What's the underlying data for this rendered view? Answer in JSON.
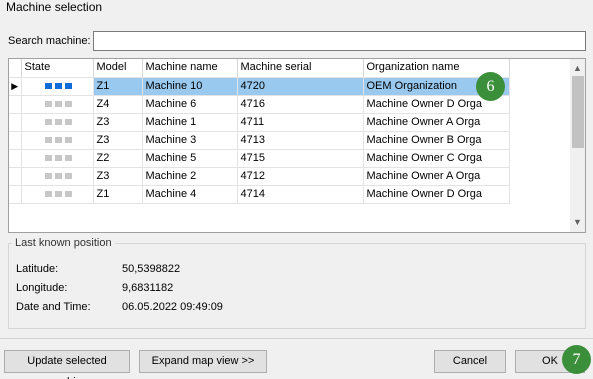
{
  "window": {
    "title": "Machine selection"
  },
  "search": {
    "label": "Search machine:",
    "value": "",
    "placeholder": ""
  },
  "table": {
    "columns": [
      "State",
      "Model",
      "Machine name",
      "Machine serial",
      "Organization name"
    ],
    "rows": [
      {
        "model": "Z1",
        "name": "Machine 10",
        "serial": "4720",
        "org": "OEM Organization",
        "selected": true
      },
      {
        "model": "Z4",
        "name": "Machine 6",
        "serial": "4716",
        "org": "Machine Owner D Orga",
        "selected": false
      },
      {
        "model": "Z3",
        "name": "Machine 1",
        "serial": "4711",
        "org": "Machine Owner A Orga",
        "selected": false
      },
      {
        "model": "Z3",
        "name": "Machine 3",
        "serial": "4713",
        "org": "Machine Owner B Orga",
        "selected": false
      },
      {
        "model": "Z2",
        "name": "Machine 5",
        "serial": "4715",
        "org": "Machine Owner C Orga",
        "selected": false
      },
      {
        "model": "Z3",
        "name": "Machine 2",
        "serial": "4712",
        "org": "Machine Owner A Orga",
        "selected": false
      },
      {
        "model": "Z1",
        "name": "Machine 4",
        "serial": "4714",
        "org": "Machine Owner D Orga",
        "selected": false
      }
    ]
  },
  "position": {
    "title": "Last known position",
    "latitude_label": "Latitude:",
    "latitude_value": "50,5398822",
    "longitude_label": "Longitude:",
    "longitude_value": "9,6831182",
    "datetime_label": "Date and Time:",
    "datetime_value": "06.05.2022 09:49:09"
  },
  "buttons": {
    "update": "Update selected machine",
    "expand": "Expand map view >>",
    "cancel": "Cancel",
    "ok": "OK"
  },
  "badges": {
    "table": "6",
    "ok": "7"
  },
  "colors": {
    "selection": "#99c9ef",
    "state_active": "#0f6cd8",
    "state_inactive": "#c7c7c7",
    "badge": "#3c8f3a"
  },
  "icons": {
    "row_marker": "row-pointer-icon",
    "scroll_up": "chevron-up-icon",
    "scroll_down": "chevron-down-icon"
  }
}
